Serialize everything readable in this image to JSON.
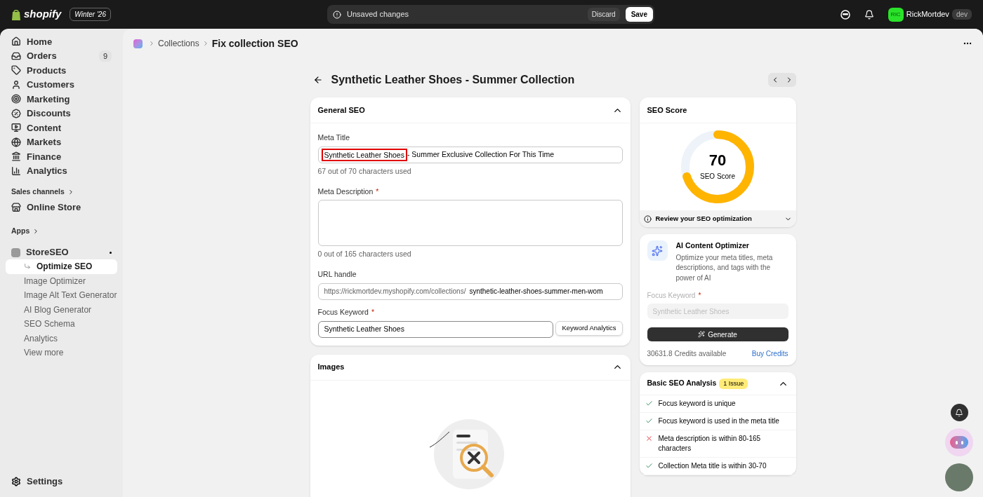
{
  "topbar": {
    "brand": "shopify",
    "edition": "Winter '26",
    "unsaved": "Unsaved changes",
    "discard": "Discard",
    "save": "Save",
    "user_initials": "RIC",
    "user": "RickMortdev",
    "user_tag": "dev"
  },
  "sidebar": {
    "items": [
      {
        "label": "Home",
        "selected": false
      },
      {
        "label": "Orders",
        "count": "9",
        "selected": false
      },
      {
        "label": "Products",
        "selected": false
      },
      {
        "label": "Customers",
        "selected": false
      },
      {
        "label": "Marketing",
        "selected": false
      },
      {
        "label": "Discounts",
        "selected": false
      },
      {
        "label": "Content",
        "selected": false
      },
      {
        "label": "Markets",
        "selected": false
      },
      {
        "label": "Finance",
        "selected": false
      },
      {
        "label": "Analytics",
        "selected": false
      }
    ],
    "sales_heading": "Sales channels",
    "sales_items": [
      {
        "label": "Online Store",
        "selected": false
      }
    ],
    "apps_heading": "Apps",
    "app": {
      "label": "StoreSEO",
      "children": [
        {
          "label": "Optimize SEO",
          "selected": true
        },
        {
          "label": "Image Optimizer",
          "selected": false
        },
        {
          "label": "Image Alt Text Generator",
          "selected": false
        },
        {
          "label": "AI Blog Generator",
          "selected": false
        },
        {
          "label": "SEO Schema",
          "selected": false
        },
        {
          "label": "Analytics",
          "selected": false
        },
        {
          "label": "View more",
          "selected": false
        }
      ]
    },
    "settings": "Settings"
  },
  "breadcrumb": {
    "parent": "Collections",
    "current": "Fix collection SEO"
  },
  "page_title": "Synthetic Leather Shoes - Summer Collection",
  "general_seo": {
    "title": "General SEO",
    "expanded": true,
    "meta_title": {
      "label": "Meta Title",
      "keyword": "Synthetic Leather Shoes",
      "rest": "- Summer Exclusive Collection For This Time",
      "hint": "67 out of 70 characters used"
    },
    "meta_description": {
      "label": "Meta Description",
      "required_mark": "*",
      "hint": "0 out of 165 characters used"
    },
    "url_handle": {
      "label": "URL handle",
      "prefix": "https://rickmortdev.myshopify.com/collections/",
      "value": "synthetic-leather-shoes-summer-men-wom"
    },
    "focus_keyword": {
      "label": "Focus Keyword",
      "required_mark": "*",
      "value": "Synthetic Leather Shoes",
      "button": "Keyword Analytics"
    }
  },
  "images": {
    "title": "Images",
    "expanded": true
  },
  "seo_score": {
    "title": "SEO Score",
    "value": "70",
    "label": "SEO Score",
    "level": 0.7,
    "review": "Review your SEO optimization"
  },
  "ai_optimizer": {
    "title": "AI Content Optimizer",
    "description": "Optimize your meta titles, meta descriptions, and tags with the power of AI",
    "keyword_label": "Focus Keyword",
    "required_mark": "*",
    "keyword_placeholder": "Synthetic Leather Shoes",
    "generate": "Generate",
    "credits": "30631.8 Credits available",
    "buy": "Buy Credits"
  },
  "analysis": {
    "title": "Basic SEO Analysis",
    "badge": "1 Issue",
    "expanded": true,
    "items": [
      {
        "text": "Focus keyword is unique",
        "passed": true
      },
      {
        "text": "Focus keyword is used in the meta title",
        "passed": true
      },
      {
        "text": "Meta description is within 80-165 characters",
        "passed": false
      },
      {
        "text": "Collection Meta title is within 30-70",
        "passed": true
      }
    ]
  }
}
